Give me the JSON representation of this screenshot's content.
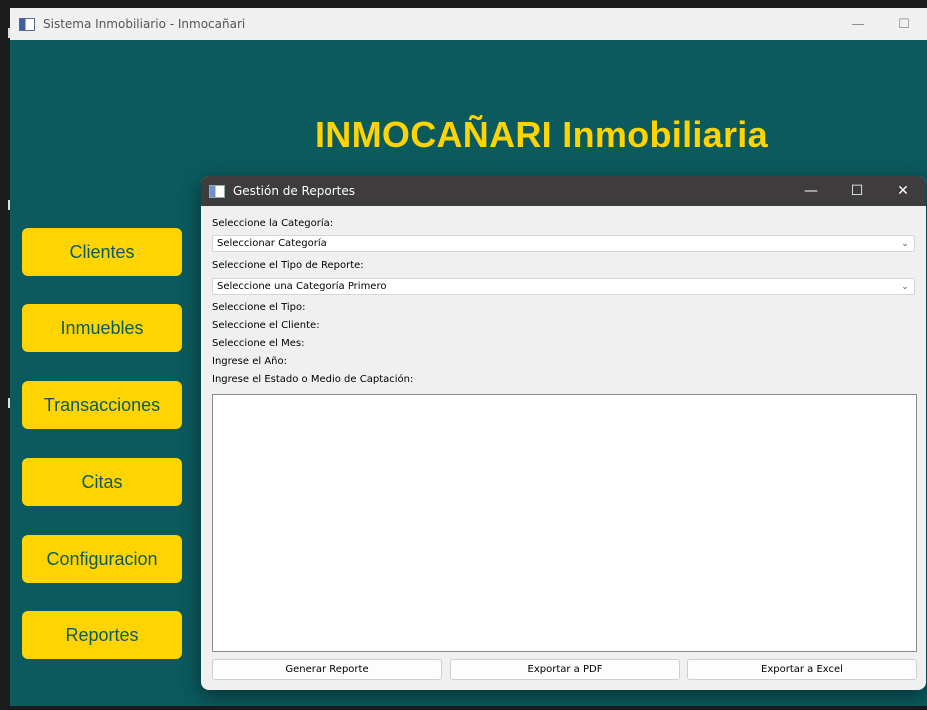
{
  "main_window": {
    "title": "Sistema Inmobiliario - Inmocañari",
    "minimize_glyph": "—",
    "maximize_glyph": "☐",
    "banner_title": "INMOCAÑARI Inmobiliaria",
    "nav": [
      {
        "label": "Clientes"
      },
      {
        "label": "Inmuebles"
      },
      {
        "label": "Transacciones"
      },
      {
        "label": "Citas"
      },
      {
        "label": "Configuracion"
      },
      {
        "label": "Reportes"
      }
    ]
  },
  "dialog": {
    "title": "Gestión de Reportes",
    "minimize_glyph": "—",
    "maximize_glyph": "☐",
    "close_glyph": "✕",
    "category_label": "Seleccione la Categoría:",
    "category_value": "Seleccionar Categoría",
    "report_type_label": "Seleccione el Tipo de Reporte:",
    "report_type_value": "Seleccione una Categoría Primero",
    "type_label": "Seleccione el Tipo:",
    "client_label": "Seleccione el Cliente:",
    "month_label": "Seleccione el Mes:",
    "year_label": "Ingrese el Año:",
    "state_label": "Ingrese el Estado o Medio de Captación:",
    "buttons": {
      "generate": "Generar Reporte",
      "pdf": "Exportar a PDF",
      "excel": "Exportar a Excel"
    }
  },
  "colors": {
    "background": "#0b5a5e",
    "accent": "#ffd400",
    "dialog_titlebar": "#3e3c3c"
  },
  "icons": [
    "app-window-icon",
    "chevron-down-icon",
    "minimize-icon",
    "maximize-icon",
    "close-icon"
  ]
}
